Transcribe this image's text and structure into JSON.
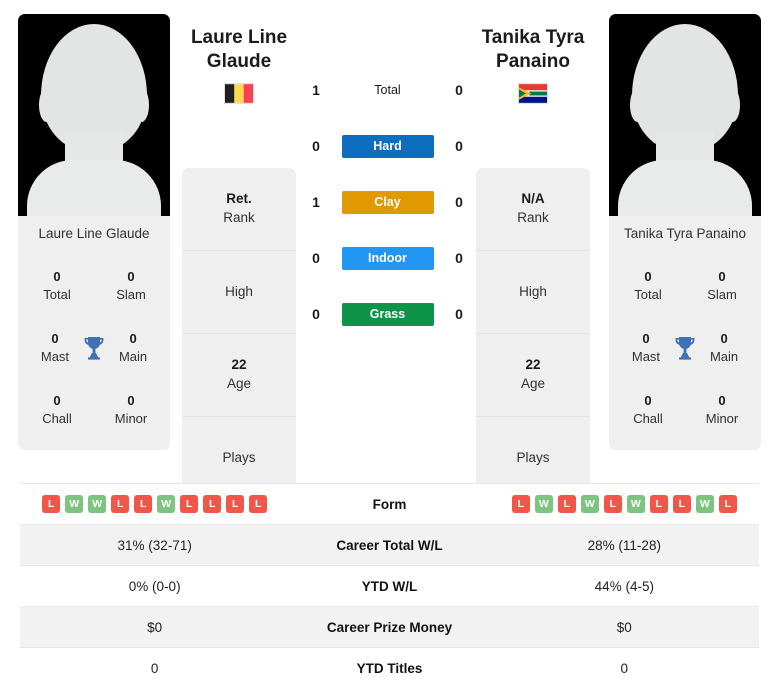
{
  "colors": {
    "hard": "#0d6ebf",
    "clay": "#e09900",
    "indoor": "#2196f3",
    "grass": "#0e9448",
    "win": "#7cc47f",
    "loss": "#f0574a",
    "trophy": "#3f72b5"
  },
  "players": {
    "left": {
      "name_line1": "Laure Line",
      "name_line2": "Glaude",
      "full_name": "Laure Line Glaude",
      "flag": "belgium-flag",
      "titles": [
        {
          "value": "0",
          "label": "Total"
        },
        {
          "value": "0",
          "label": "Slam"
        },
        {
          "value": "0",
          "label": "Mast"
        },
        {
          "value": "0",
          "label": "Main"
        },
        {
          "value": "0",
          "label": "Chall"
        },
        {
          "value": "0",
          "label": "Minor"
        }
      ],
      "info": [
        {
          "value": "Ret.",
          "label": "Rank"
        },
        {
          "value": "",
          "label": "High"
        },
        {
          "value": "22",
          "label": "Age"
        },
        {
          "value": "",
          "label": "Plays"
        }
      ],
      "form": [
        "L",
        "W",
        "W",
        "L",
        "L",
        "W",
        "L",
        "L",
        "L",
        "L"
      ],
      "career_wl": "31% (32-71)",
      "ytd_wl": "0% (0-0)",
      "career_prize": "$0",
      "ytd_titles": "0"
    },
    "right": {
      "name_line1": "Tanika Tyra",
      "name_line2": "Panaino",
      "full_name": "Tanika Tyra Panaino",
      "flag": "south-africa-flag",
      "titles": [
        {
          "value": "0",
          "label": "Total"
        },
        {
          "value": "0",
          "label": "Slam"
        },
        {
          "value": "0",
          "label": "Mast"
        },
        {
          "value": "0",
          "label": "Main"
        },
        {
          "value": "0",
          "label": "Chall"
        },
        {
          "value": "0",
          "label": "Minor"
        }
      ],
      "info": [
        {
          "value": "N/A",
          "label": "Rank"
        },
        {
          "value": "",
          "label": "High"
        },
        {
          "value": "22",
          "label": "Age"
        },
        {
          "value": "",
          "label": "Plays"
        }
      ],
      "form": [
        "L",
        "W",
        "L",
        "W",
        "L",
        "W",
        "L",
        "L",
        "W",
        "L"
      ],
      "career_wl": "28% (11-28)",
      "ytd_wl": "44% (4-5)",
      "career_prize": "$0",
      "ytd_titles": "0"
    }
  },
  "head_to_head": [
    {
      "left": "1",
      "surface": "Total",
      "right": "0",
      "style": "plain"
    },
    {
      "left": "0",
      "surface": "Hard",
      "right": "0",
      "style": "hard"
    },
    {
      "left": "1",
      "surface": "Clay",
      "right": "0",
      "style": "clay"
    },
    {
      "left": "0",
      "surface": "Indoor",
      "right": "0",
      "style": "indoor"
    },
    {
      "left": "0",
      "surface": "Grass",
      "right": "0",
      "style": "grass"
    }
  ],
  "table_rows": [
    {
      "label": "Form",
      "type": "form"
    },
    {
      "label": "Career Total W/L",
      "type": "text",
      "left": "31% (32-71)",
      "right": "28% (11-28)"
    },
    {
      "label": "YTD W/L",
      "type": "text",
      "left": "0% (0-0)",
      "right": "44% (4-5)"
    },
    {
      "label": "Career Prize Money",
      "type": "text",
      "left": "$0",
      "right": "$0"
    },
    {
      "label": "YTD Titles",
      "type": "text",
      "left": "0",
      "right": "0"
    }
  ]
}
